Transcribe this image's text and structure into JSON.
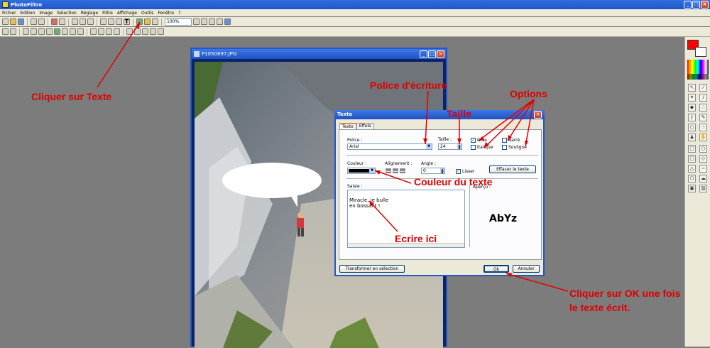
{
  "app": {
    "title": "PhotoFiltre"
  },
  "menu": [
    "Fichier",
    "Edition",
    "Image",
    "Sélection",
    "Réglage",
    "Filtre",
    "Affichage",
    "Outils",
    "Fenêtre",
    "?"
  ],
  "toolbar": {
    "zoom": "100%"
  },
  "image_window": {
    "title": "P1050897.JPG"
  },
  "dialog": {
    "title": "Texte",
    "tabs": [
      "Texte",
      "Effets"
    ],
    "police_label": "Police :",
    "police_value": "Arial",
    "taille_label": "Taille :",
    "taille_value": "24",
    "gras": "Gras",
    "italique": "Italique",
    "barre": "Barré",
    "souligne": "Souligné",
    "couleur_label": "Couleur :",
    "alignement_label": "Alignement :",
    "angle_label": "Angle :",
    "angle_value": "0",
    "lisser": "Lisser",
    "effacer_btn": "Effacer le texte",
    "saisie_label": "Saisie :",
    "saisie_text": "Miracle, je bulle\nen bossant !",
    "apercu_label": "Aperçu :",
    "apercu_text": "AbYz",
    "transformer_btn": "Transformer en sélection",
    "ok_btn": "Ok",
    "annuler_btn": "Annuler"
  },
  "annotations": {
    "cliquer_texte": "Cliquer sur Texte",
    "police": "Police d'écriture",
    "taille": "Taille",
    "options": "Options",
    "couleur": "Couleur du texte",
    "ecrire": "Ecrire ici",
    "ok_line1": "Cliquer sur OK une fois",
    "ok_line2": "le texte écrit."
  },
  "colors": {
    "annotation": "#e00000",
    "primary_color": "#ff0000",
    "secondary_color": "#ffffff"
  }
}
